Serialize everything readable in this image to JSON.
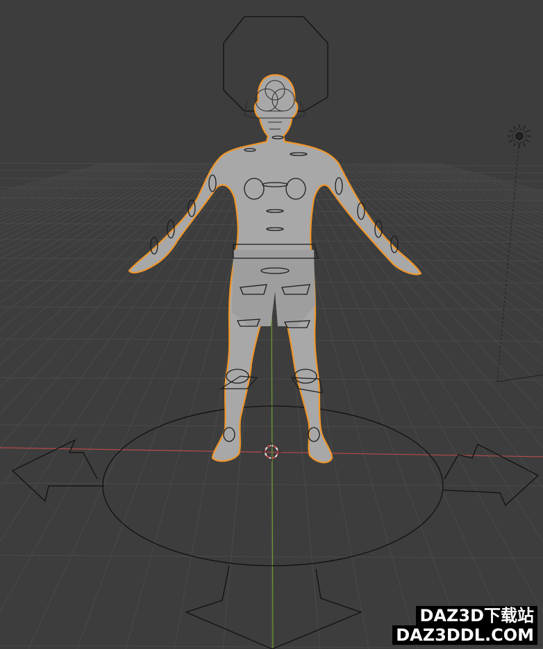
{
  "viewport": {
    "background": "#3d3d3d",
    "grid_color": "#4a4a4a",
    "x_axis_color": "#c04848",
    "y_axis_color": "#6b9a2e",
    "selection_outline_color": "#f0962a",
    "mesh_color": "#a8a8a8"
  },
  "objects": {
    "character": "human-base-mesh",
    "armature": "rig-controls",
    "light": "sun-light-icon",
    "cursor": "3d-cursor-icon"
  },
  "watermark": {
    "line1": "DAZ3D下载站",
    "line2": "DAZ3DDL.COM"
  }
}
